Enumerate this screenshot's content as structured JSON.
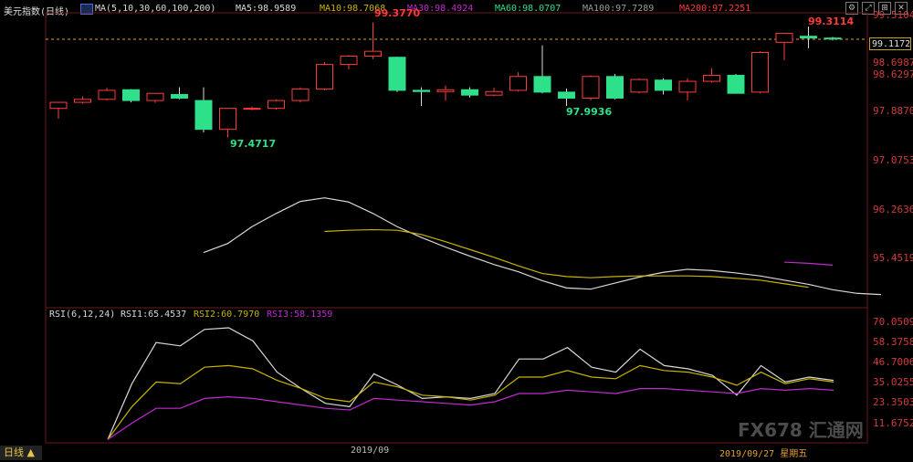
{
  "header": {
    "title": "美元指数(日线)",
    "ma_params": "MA(5,10,30,60,100,200)",
    "ma5": "MA5:98.9589",
    "ma10": "MA10:98.7068",
    "ma30": "MA30:98.4924",
    "ma60": "MA60:98.0707",
    "ma100": "MA100:97.7289",
    "ma200": "MA200:97.2251"
  },
  "rsi_header": {
    "params": "RSI(6,12,24)",
    "rsi1": "RSI1:65.4537",
    "rsi2": "RSI2:60.7970",
    "rsi3": "RSI3:58.1359"
  },
  "price_axis": {
    "ticks": [
      "99.5104",
      "98.6987",
      "97.8870",
      "97.0753",
      "96.2636",
      "95.4519"
    ],
    "current_price": "99.1172",
    "side_value": "98.6297"
  },
  "rsi_axis": {
    "ticks": [
      "70.0509",
      "58.3758",
      "46.7006",
      "35.0255",
      "23.3503",
      "11.6752"
    ]
  },
  "annotations": {
    "high1": "99.3770",
    "low1": "97.4717",
    "low2": "97.9936",
    "high2": "99.3114"
  },
  "dates": {
    "month": "2019/09",
    "current": "2019/09/27 星期五"
  },
  "footer": {
    "tab_label": "日线 ▲"
  },
  "watermark": "FX678 汇通网",
  "colors": {
    "up": "#ff3b3b",
    "down": "#2ee08a",
    "ma_white": "#d8d8d8",
    "ma_yellow": "#c8b400",
    "ma_magenta": "#c02ad0"
  },
  "chart_data": {
    "type": "candlestick",
    "price_range": [
      95.4519,
      99.5104
    ],
    "candles": [
      {
        "o": 97.95,
        "h": 98.06,
        "l": 97.78,
        "c": 98.05
      },
      {
        "o": 98.05,
        "h": 98.15,
        "l": 98.03,
        "c": 98.1
      },
      {
        "o": 98.1,
        "h": 98.29,
        "l": 98.08,
        "c": 98.25
      },
      {
        "o": 98.26,
        "h": 98.27,
        "l": 98.05,
        "c": 98.08
      },
      {
        "o": 98.08,
        "h": 98.2,
        "l": 98.04,
        "c": 98.2
      },
      {
        "o": 98.18,
        "h": 98.3,
        "l": 98.1,
        "c": 98.12
      },
      {
        "o": 98.08,
        "h": 98.3,
        "l": 97.55,
        "c": 97.6
      },
      {
        "o": 97.6,
        "h": 97.95,
        "l": 97.47,
        "c": 97.95
      },
      {
        "o": 97.95,
        "h": 97.98,
        "l": 97.92,
        "c": 97.95
      },
      {
        "o": 97.95,
        "h": 98.1,
        "l": 97.93,
        "c": 98.08
      },
      {
        "o": 98.08,
        "h": 98.3,
        "l": 98.05,
        "c": 98.27
      },
      {
        "o": 98.27,
        "h": 98.72,
        "l": 98.25,
        "c": 98.68
      },
      {
        "o": 98.68,
        "h": 98.84,
        "l": 98.6,
        "c": 98.82
      },
      {
        "o": 98.82,
        "h": 99.38,
        "l": 98.77,
        "c": 98.9
      },
      {
        "o": 98.8,
        "h": 98.81,
        "l": 98.22,
        "c": 98.25
      },
      {
        "o": 98.25,
        "h": 98.3,
        "l": 97.99,
        "c": 98.23
      },
      {
        "o": 98.23,
        "h": 98.33,
        "l": 98.08,
        "c": 98.26
      },
      {
        "o": 98.26,
        "h": 98.3,
        "l": 98.13,
        "c": 98.17
      },
      {
        "o": 98.17,
        "h": 98.29,
        "l": 98.15,
        "c": 98.23
      },
      {
        "o": 98.25,
        "h": 98.55,
        "l": 98.23,
        "c": 98.48
      },
      {
        "o": 98.48,
        "h": 99.0,
        "l": 98.2,
        "c": 98.22
      },
      {
        "o": 98.22,
        "h": 98.28,
        "l": 97.99,
        "c": 98.12
      },
      {
        "o": 98.12,
        "h": 98.5,
        "l": 98.08,
        "c": 98.48
      },
      {
        "o": 98.48,
        "h": 98.52,
        "l": 98.1,
        "c": 98.12
      },
      {
        "o": 98.22,
        "h": 98.45,
        "l": 98.2,
        "c": 98.43
      },
      {
        "o": 98.42,
        "h": 98.45,
        "l": 98.18,
        "c": 98.25
      },
      {
        "o": 98.22,
        "h": 98.45,
        "l": 98.08,
        "c": 98.4
      },
      {
        "o": 98.4,
        "h": 98.62,
        "l": 98.38,
        "c": 98.5
      },
      {
        "o": 98.5,
        "h": 98.52,
        "l": 98.2,
        "c": 98.2
      },
      {
        "o": 98.22,
        "h": 98.9,
        "l": 98.2,
        "c": 98.88
      },
      {
        "o": 99.05,
        "h": 99.2,
        "l": 98.75,
        "c": 99.2
      },
      {
        "o": 99.15,
        "h": 99.31,
        "l": 98.95,
        "c": 99.12
      },
      {
        "o": 99.12,
        "h": 99.14,
        "l": 99.08,
        "c": 99.11
      }
    ],
    "ma_lines": [
      {
        "name": "MA5",
        "color": "#d8d8d8",
        "points": [
          [
            6,
            95.55
          ],
          [
            7,
            95.7
          ],
          [
            8,
            95.98
          ],
          [
            9,
            96.2
          ],
          [
            10,
            96.4
          ],
          [
            11,
            96.46
          ],
          [
            12,
            96.39
          ],
          [
            13,
            96.2
          ],
          [
            14,
            95.98
          ],
          [
            15,
            95.8
          ],
          [
            16,
            95.64
          ],
          [
            17,
            95.49
          ],
          [
            18,
            95.35
          ],
          [
            19,
            95.23
          ],
          [
            20,
            95.08
          ],
          [
            21,
            94.96
          ],
          [
            22,
            94.94
          ],
          [
            23,
            95.04
          ],
          [
            24,
            95.14
          ],
          [
            25,
            95.22
          ],
          [
            26,
            95.27
          ],
          [
            27,
            95.25
          ],
          [
            28,
            95.21
          ],
          [
            29,
            95.16
          ],
          [
            30,
            95.09
          ],
          [
            31,
            95.02
          ],
          [
            32,
            94.93
          ],
          [
            33,
            94.87
          ],
          [
            34,
            94.85
          ]
        ]
      },
      {
        "name": "MA10",
        "color": "#c8b400",
        "points": [
          [
            11,
            95.9
          ],
          [
            12,
            95.92
          ],
          [
            13,
            95.93
          ],
          [
            14,
            95.92
          ],
          [
            15,
            95.85
          ],
          [
            16,
            95.73
          ],
          [
            17,
            95.6
          ],
          [
            18,
            95.47
          ],
          [
            19,
            95.33
          ],
          [
            20,
            95.2
          ],
          [
            21,
            95.15
          ],
          [
            22,
            95.13
          ],
          [
            23,
            95.15
          ],
          [
            24,
            95.16
          ],
          [
            25,
            95.16
          ],
          [
            26,
            95.16
          ],
          [
            27,
            95.15
          ],
          [
            28,
            95.12
          ],
          [
            29,
            95.09
          ],
          [
            30,
            95.03
          ],
          [
            31,
            94.97
          ]
        ]
      },
      {
        "name": "MA30",
        "color": "#c02ad0",
        "points": [
          [
            30,
            95.39
          ],
          [
            31,
            95.37
          ],
          [
            32,
            95.34
          ]
        ]
      }
    ],
    "rsi_range": [
      0,
      75
    ],
    "rsi_lines": [
      {
        "name": "RSI1",
        "color": "#d8d8d8",
        "points": [
          [
            0,
            2
          ],
          [
            1,
            36
          ],
          [
            2,
            61
          ],
          [
            3,
            59
          ],
          [
            4,
            69
          ],
          [
            5,
            70
          ],
          [
            6,
            62
          ],
          [
            7,
            43
          ],
          [
            8,
            33
          ],
          [
            9,
            24
          ],
          [
            10,
            22
          ],
          [
            11,
            42
          ],
          [
            12,
            35
          ],
          [
            13,
            27
          ],
          [
            14,
            28
          ],
          [
            15,
            27
          ],
          [
            16,
            30
          ],
          [
            17,
            51
          ],
          [
            18,
            51
          ],
          [
            19,
            58
          ],
          [
            20,
            46
          ],
          [
            21,
            43
          ],
          [
            22,
            57
          ],
          [
            23,
            47
          ],
          [
            24,
            45
          ],
          [
            25,
            41
          ],
          [
            26,
            29
          ],
          [
            27,
            47
          ],
          [
            28,
            37
          ],
          [
            29,
            40
          ],
          [
            30,
            38
          ]
        ]
      },
      {
        "name": "RSI2",
        "color": "#c8b400",
        "points": [
          [
            0,
            2
          ],
          [
            1,
            22
          ],
          [
            2,
            37
          ],
          [
            3,
            36
          ],
          [
            4,
            46
          ],
          [
            5,
            47
          ],
          [
            6,
            45
          ],
          [
            7,
            38
          ],
          [
            8,
            33
          ],
          [
            9,
            27
          ],
          [
            10,
            25
          ],
          [
            11,
            37
          ],
          [
            12,
            34
          ],
          [
            13,
            29
          ],
          [
            14,
            28
          ],
          [
            15,
            26
          ],
          [
            16,
            29
          ],
          [
            17,
            40
          ],
          [
            18,
            40
          ],
          [
            19,
            44
          ],
          [
            20,
            40
          ],
          [
            21,
            39
          ],
          [
            22,
            47
          ],
          [
            23,
            44
          ],
          [
            24,
            43
          ],
          [
            25,
            40
          ],
          [
            26,
            35
          ],
          [
            27,
            43
          ],
          [
            28,
            36
          ],
          [
            29,
            39
          ],
          [
            30,
            37
          ]
        ]
      },
      {
        "name": "RSI3",
        "color": "#c02ad0",
        "points": [
          [
            0,
            2
          ],
          [
            1,
            12
          ],
          [
            2,
            21
          ],
          [
            3,
            21
          ],
          [
            4,
            27
          ],
          [
            5,
            28
          ],
          [
            6,
            27
          ],
          [
            7,
            25
          ],
          [
            8,
            23
          ],
          [
            9,
            21
          ],
          [
            10,
            20
          ],
          [
            11,
            27
          ],
          [
            12,
            26
          ],
          [
            13,
            25
          ],
          [
            14,
            24
          ],
          [
            15,
            23
          ],
          [
            16,
            25
          ],
          [
            17,
            30
          ],
          [
            18,
            30
          ],
          [
            19,
            32
          ],
          [
            20,
            31
          ],
          [
            21,
            30
          ],
          [
            22,
            33
          ],
          [
            23,
            33
          ],
          [
            24,
            32
          ],
          [
            25,
            31
          ],
          [
            26,
            30
          ],
          [
            27,
            33
          ],
          [
            28,
            32
          ],
          [
            29,
            33
          ],
          [
            30,
            32
          ]
        ]
      }
    ]
  }
}
